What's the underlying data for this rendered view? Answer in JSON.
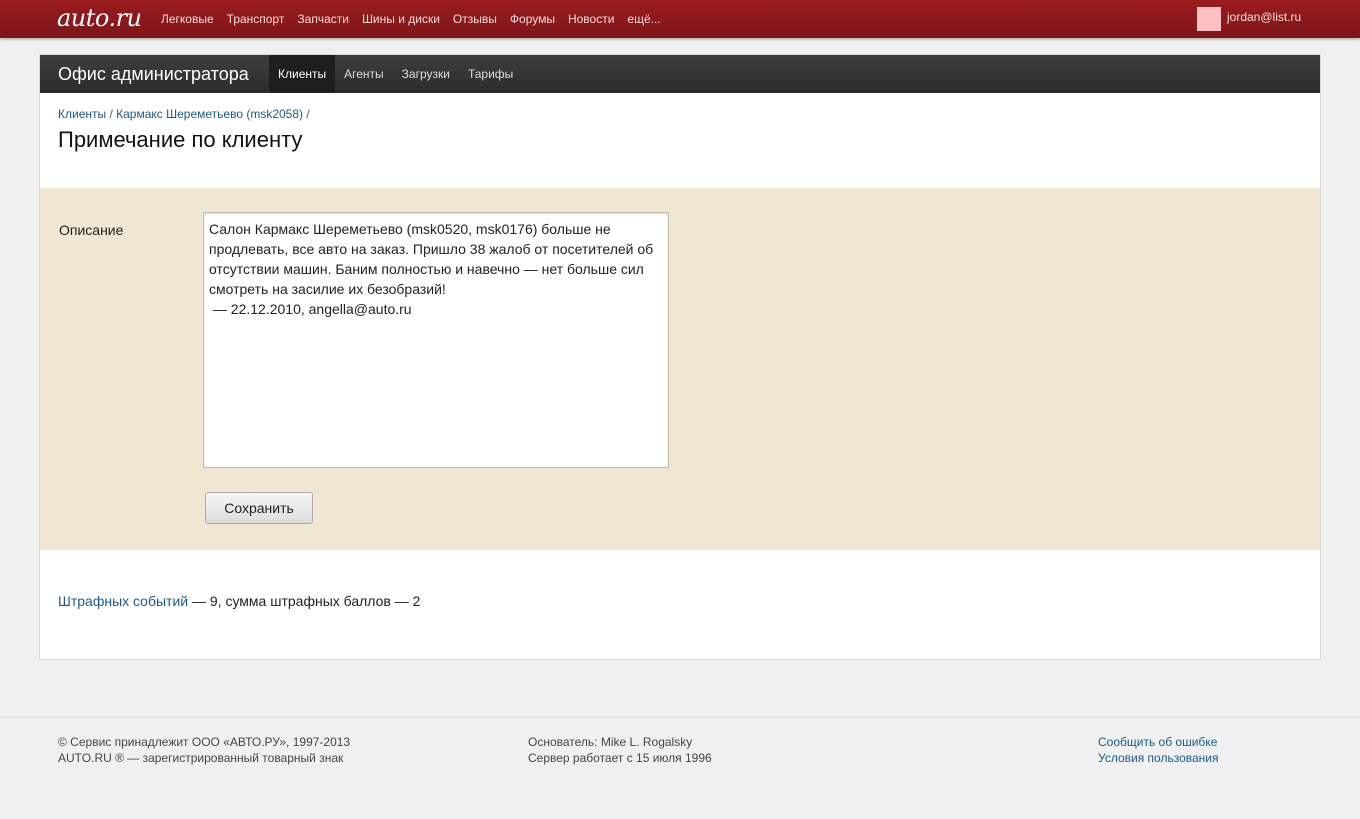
{
  "topbar": {
    "logo": "auto.ru",
    "nav": [
      "Легковые",
      "Транспорт",
      "Запчасти",
      "Шины и диски",
      "Отзывы",
      "Форумы",
      "Новости",
      "ещё..."
    ],
    "user_email": "jordan@list.ru",
    "avatar_color": "#ffc0c0"
  },
  "office": {
    "title": "Офис администратора",
    "tabs": [
      {
        "label": "Клиенты",
        "active": true
      },
      {
        "label": "Агенты",
        "active": false
      },
      {
        "label": "Загрузки",
        "active": false
      },
      {
        "label": "Тарифы",
        "active": false
      }
    ]
  },
  "breadcrumb": {
    "items": [
      "Клиенты",
      "Кармакс Шереметьево (msk2058)"
    ],
    "separator": "/"
  },
  "page_title": "Примечание по клиенту",
  "form": {
    "description_label": "Описание",
    "description_value": "Салон Кармакс Шереметьево (msk0520, msk0176) больше не продлевать, все авто на заказ. Пришло 38 жалоб от посетителей об отсутствии машин. Баним полностью и навечно — нет больше сил смотреть на засилие их безобразий!\n — 22.12.2010, angella@auto.ru",
    "save_label": "Сохранить"
  },
  "penalty": {
    "link_text": "Штрафных событий",
    "rest_text": " — 9, сумма штрафных баллов — 2"
  },
  "footer": {
    "col1": [
      "© Сервис принадлежит ООО «АВТО.РУ», 1997-2013",
      "AUTO.RU ® — зарегистрированный товарный знак"
    ],
    "col2": [
      "Основатель: Mike L. Rogalsky",
      "Сервер работает с 15 июля 1996"
    ],
    "col3": [
      "Сообщить об ошибке",
      "Условия пользования"
    ]
  },
  "colors": {
    "topbar": "#8a181c",
    "office_bar": "#333333",
    "form_bg": "#efe7d1",
    "link": "#1a5a8a"
  }
}
